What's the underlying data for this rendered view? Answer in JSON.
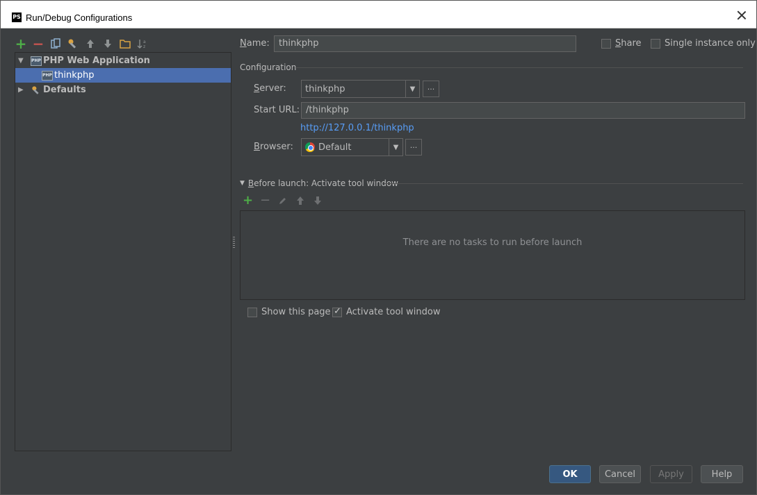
{
  "window": {
    "title": "Run/Debug Configurations",
    "logo_text": "PS"
  },
  "toolbar": {
    "icons": [
      "add-icon",
      "remove-icon",
      "copy-icon",
      "edit-defaults-icon",
      "move-up-icon",
      "move-down-icon",
      "folder-icon",
      "sort-icon"
    ]
  },
  "tree": {
    "group": "PHP Web Application",
    "child": "thinkphp",
    "defaults": "Defaults"
  },
  "form": {
    "name_label": "Name:",
    "name_value": "thinkphp",
    "share_label": "Share",
    "single_instance_label": "Single instance only",
    "configuration_label": "Configuration",
    "server_label": "Server:",
    "server_value": "thinkphp",
    "start_url_label": "Start URL:",
    "start_url_value": "/thinkphp",
    "url_link": "http://127.0.0.1/thinkphp",
    "browser_label": "Browser:",
    "browser_value": "Default",
    "dots": "..."
  },
  "before_launch": {
    "title": "Before launch: Activate tool window",
    "empty_text": "There are no tasks to run before launch",
    "show_page_label": "Show this page",
    "activate_label": "Activate tool window"
  },
  "buttons": {
    "ok": "OK",
    "cancel": "Cancel",
    "apply": "Apply",
    "help": "Help"
  }
}
